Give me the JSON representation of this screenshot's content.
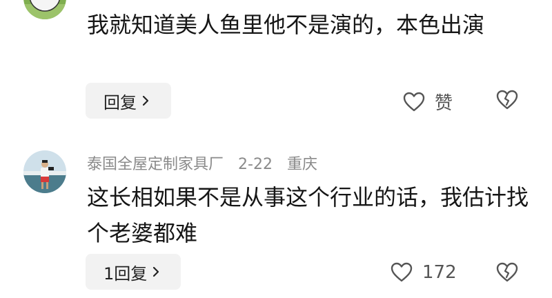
{
  "comments": [
    {
      "username": "",
      "date": "",
      "location": "",
      "text": "我就知道美人鱼里他不是演的，本色出演",
      "reply_label": "回复",
      "like_label": "赞"
    },
    {
      "username": "泰国全屋定制家具厂",
      "date": "2-22",
      "location": "重庆",
      "text": "这长相如果不是从事这个行业的话，我估计找个老婆都难",
      "reply_label": "1回复",
      "like_label": "172"
    }
  ],
  "icons": {
    "like": "heart-outline-icon",
    "dislike": "broken-heart-icon",
    "chevron": "chevron-right-icon"
  },
  "colors": {
    "text": "#161616",
    "meta": "#8a8a8a",
    "button_bg": "#f2f2f2",
    "icon": "#555555"
  }
}
